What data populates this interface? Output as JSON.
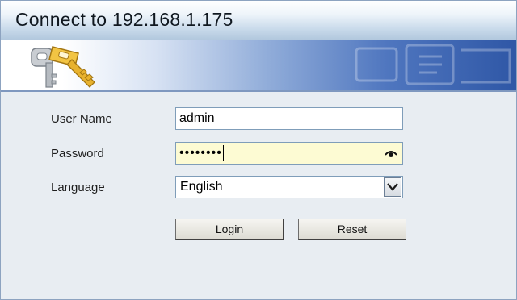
{
  "dialog": {
    "title": "Connect to 192.168.1.175"
  },
  "banner": {
    "icon": "keys-icon"
  },
  "form": {
    "username_label": "User Name",
    "username_value": "admin",
    "password_label": "Password",
    "password_mask": "••••••••",
    "password_icon": "eye-icon",
    "language_label": "Language",
    "language_value": "English",
    "language_arrow_icon": "chevron-down-icon"
  },
  "buttons": {
    "login_label": "Login",
    "reset_label": "Reset"
  },
  "colors": {
    "password_highlight": "#fdfbd3",
    "banner_blue": "#2f57a6"
  }
}
